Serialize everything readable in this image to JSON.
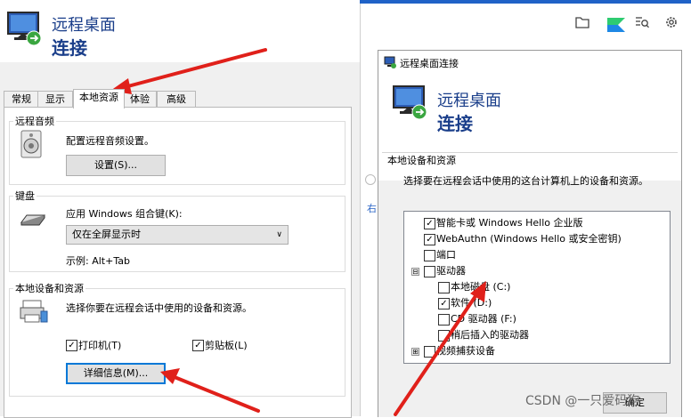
{
  "left_window": {
    "title_line1": "远程桌面",
    "title_line2": "连接",
    "tabs": [
      "常规",
      "显示",
      "本地资源",
      "体验",
      "高级"
    ],
    "active_tab": "本地资源",
    "audio": {
      "legend": "远程音频",
      "description": "配置远程音频设置。",
      "settings_button": "设置(S)..."
    },
    "keyboard": {
      "legend": "键盘",
      "label": "应用 Windows 组合键(K):",
      "selected": "仅在全屏显示时",
      "example": "示例: Alt+Tab"
    },
    "local_devices": {
      "legend": "本地设备和资源",
      "description": "选择你要在远程会话中使用的设备和资源。",
      "printer_label": "打印机(T)",
      "printer_checked": true,
      "clipboard_label": "剪贴板(L)",
      "clipboard_checked": true,
      "details_button": "详细信息(M)..."
    }
  },
  "right_window": {
    "top_icons": [
      "folder-icon",
      "app-logo-icon",
      "search-icon",
      "gear-icon"
    ],
    "dialog": {
      "title": "远程桌面连接",
      "header_line1": "远程桌面",
      "header_line2": "连接",
      "section_label": "本地设备和资源",
      "description": "选择要在远程会话中使用的这台计算机上的设备和资源。",
      "items": [
        {
          "label": "智能卡或 Windows Hello 企业版",
          "checked": true,
          "level": 0
        },
        {
          "label": "WebAuthn (Windows Hello 或安全密钥)",
          "checked": true,
          "level": 0
        },
        {
          "label": "端口",
          "checked": false,
          "level": 0
        },
        {
          "label": "驱动器",
          "checked": false,
          "level": 0,
          "expander": "⊟"
        },
        {
          "label": "本地磁盘 (C:)",
          "checked": false,
          "level": 1
        },
        {
          "label": "软件 (D:)",
          "checked": true,
          "level": 1
        },
        {
          "label": "CD 驱动器 (F:)",
          "checked": false,
          "level": 1
        },
        {
          "label": "稍后插入的驱动器",
          "checked": false,
          "level": 1
        },
        {
          "label": "视频捕获设备",
          "checked": false,
          "level": 0,
          "expander": "⊞"
        }
      ],
      "ok_button": "确定"
    },
    "side_fragment": "右"
  },
  "watermark": "CSDN @一只爱码狗",
  "colors": {
    "title_blue": "#1a3e8a",
    "accent_blue": "#1f62c7",
    "focus_blue": "#0078d7",
    "arrow_red": "#e0201a"
  }
}
